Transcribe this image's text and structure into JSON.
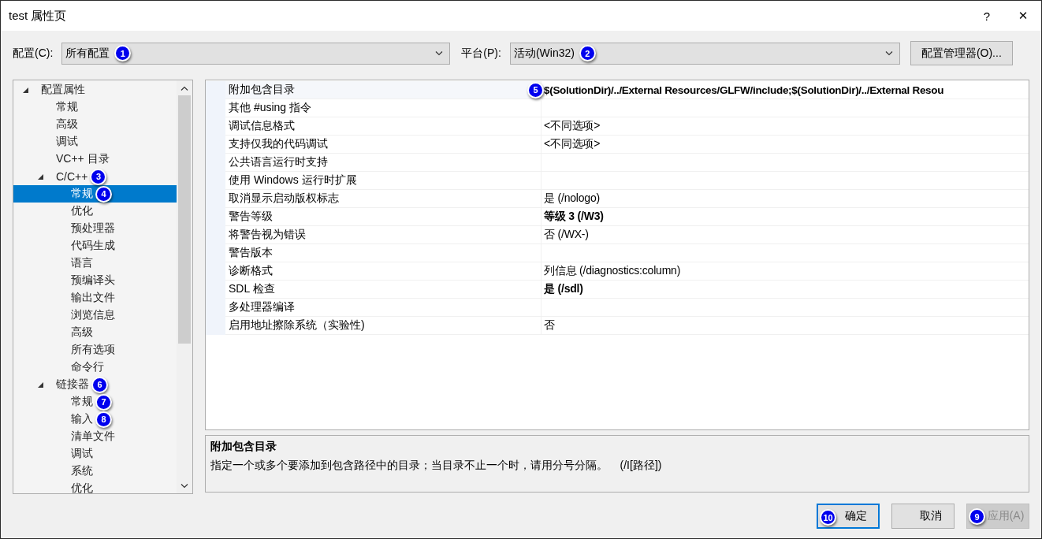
{
  "window": {
    "title": "test 属性页",
    "help": "?",
    "close": "✕"
  },
  "config": {
    "label": "配置(C):",
    "value": "所有配置",
    "badge": "1"
  },
  "platform": {
    "label": "平台(P):",
    "value": "活动(Win32)",
    "badge": "2"
  },
  "config_manager": "配置管理器(O)...",
  "tree": [
    {
      "label": "配置属性",
      "expanded": true,
      "selected": false,
      "children": [
        {
          "label": "常规",
          "selected": false
        },
        {
          "label": "高级",
          "selected": false
        },
        {
          "label": "调试",
          "selected": false
        },
        {
          "label": "VC++ 目录",
          "selected": false
        },
        {
          "label": "C/C++",
          "expanded": true,
          "selected": false,
          "badge": "3",
          "children": [
            {
              "label": "常规",
              "selected": true,
              "badge": "4"
            },
            {
              "label": "优化",
              "selected": false
            },
            {
              "label": "预处理器",
              "selected": false
            },
            {
              "label": "代码生成",
              "selected": false
            },
            {
              "label": "语言",
              "selected": false
            },
            {
              "label": "预编译头",
              "selected": false
            },
            {
              "label": "输出文件",
              "selected": false
            },
            {
              "label": "浏览信息",
              "selected": false
            },
            {
              "label": "高级",
              "selected": false
            },
            {
              "label": "所有选项",
              "selected": false
            },
            {
              "label": "命令行",
              "selected": false
            }
          ]
        },
        {
          "label": "链接器",
          "expanded": true,
          "selected": false,
          "badge": "6",
          "children": [
            {
              "label": "常规",
              "selected": false,
              "badge": "7"
            },
            {
              "label": "输入",
              "selected": false,
              "badge": "8"
            },
            {
              "label": "清单文件",
              "selected": false
            },
            {
              "label": "调试",
              "selected": false
            },
            {
              "label": "系统",
              "selected": false
            },
            {
              "label": "优化",
              "selected": false
            }
          ]
        }
      ]
    }
  ],
  "properties": [
    {
      "name": "附加包含目录",
      "value": "$(SolutionDir)/../External Resources/GLFW/include;$(SolutionDir)/../External Resou",
      "bold": true,
      "badge": "5"
    },
    {
      "name": "其他 #using 指令"
    },
    {
      "name": "调试信息格式",
      "value": "<不同选项>",
      "bold": false
    },
    {
      "name": "支持仅我的代码调试",
      "value": "<不同选项>",
      "bold": false
    },
    {
      "name": "公共语言运行时支持"
    },
    {
      "name": "使用 Windows 运行时扩展"
    },
    {
      "name": "取消显示启动版权标志",
      "value": "是 (/nologo)",
      "bold": false
    },
    {
      "name": "警告等级",
      "value": "等级 3 (/W3)",
      "bold": true
    },
    {
      "name": "将警告视为错误",
      "value": "否 (/WX-)",
      "bold": false
    },
    {
      "name": "警告版本"
    },
    {
      "name": "诊断格式",
      "value": "列信息 (/diagnostics:column)",
      "bold": false
    },
    {
      "name": "SDL 检查",
      "value": "是 (/sdl)",
      "bold": true
    },
    {
      "name": "多处理器编译"
    },
    {
      "name": "启用地址擦除系统（实验性)",
      "value": "否",
      "bold": false
    }
  ],
  "description": {
    "title": "附加包含目录",
    "text": "指定一个或多个要添加到包含路径中的目录；当目录不止一个时，请用分号分隔。    (/I[路径])"
  },
  "buttons": [
    {
      "label": "确定",
      "kind": "default",
      "disabled": false,
      "badge": "10"
    },
    {
      "label": "取消",
      "kind": "normal",
      "disabled": false
    },
    {
      "label": "应用(A)",
      "kind": "normal",
      "disabled": true,
      "badge": "9"
    }
  ]
}
